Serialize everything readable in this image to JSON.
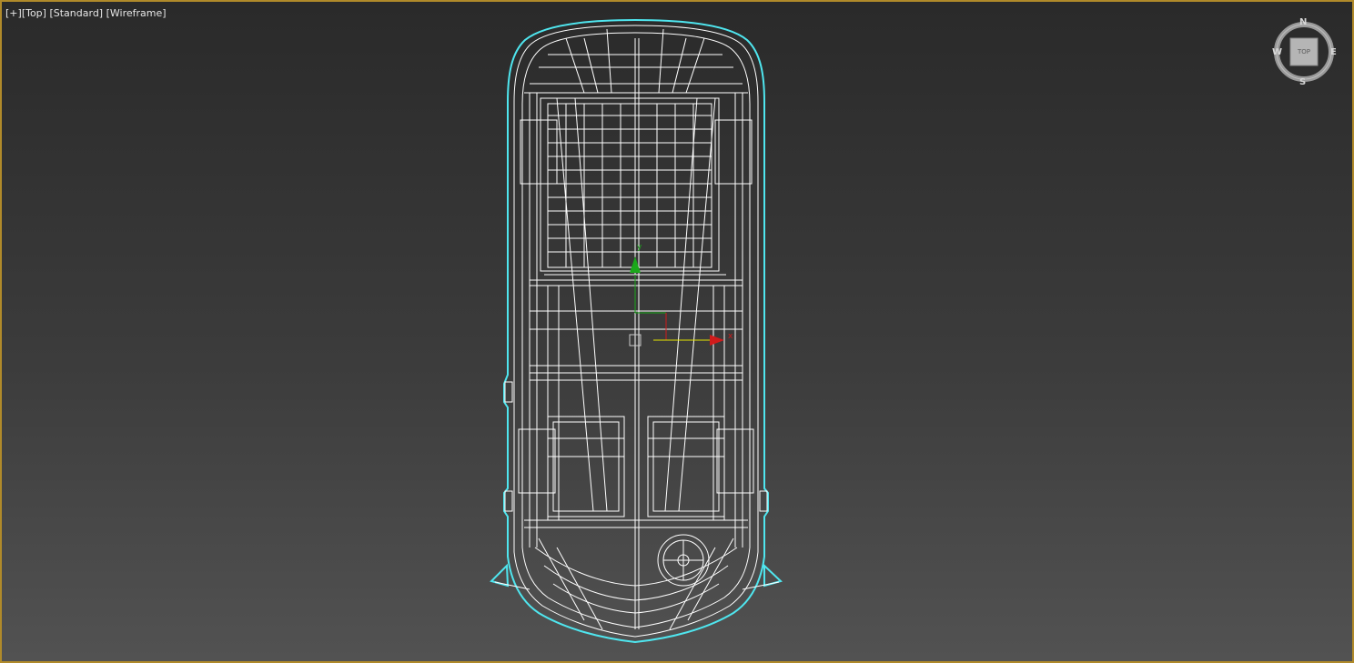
{
  "viewport": {
    "label_plus": "[+]",
    "label_view": "[Top]",
    "label_shading": "[Standard]",
    "label_mode": "[Wireframe]",
    "border_color": "#b08a2a",
    "wire_color": "#ffffff",
    "selection_color": "#4fe6ef"
  },
  "viewcube": {
    "face": "TOP",
    "north": "N",
    "south": "S",
    "east": "E",
    "west": "W"
  },
  "gizmo": {
    "x_label": "x",
    "y_label": "y",
    "x_color": "#d01b1b",
    "y_color": "#1ba81b"
  },
  "model": {
    "name": "car-wireframe-top"
  }
}
